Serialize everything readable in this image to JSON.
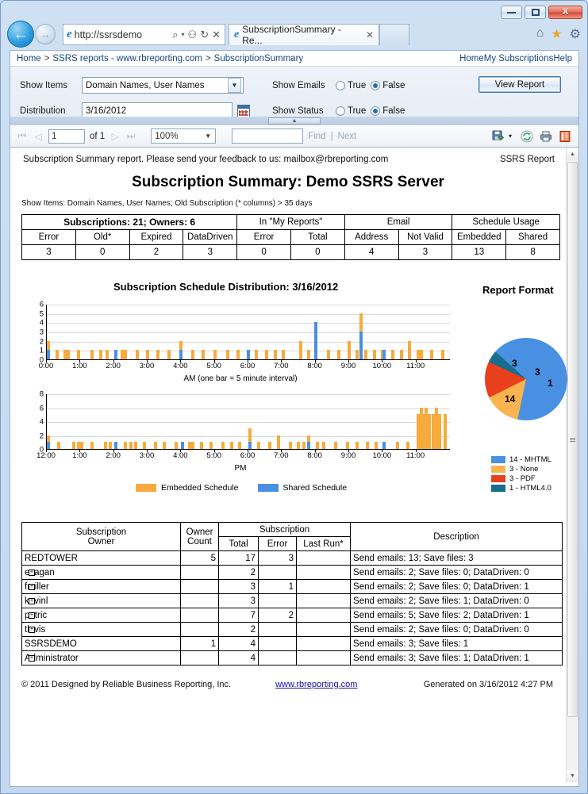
{
  "window": {
    "minimize_label": "minimize",
    "maximize_label": "maximize",
    "close_label": "X"
  },
  "browser": {
    "back_label": "←",
    "forward_label": "→",
    "address_value": "http://ssrsdemo",
    "search_icon": "⌕",
    "dropdown_icon": "▾",
    "compat_icon": "⚇",
    "refresh_icon": "↻",
    "stop_icon": "✕",
    "tab_title": "SubscriptionSummary - Re...",
    "tab_close": "✕",
    "home_icon": "⌂",
    "favorites_icon": "★",
    "tools_icon": "⚙"
  },
  "breadcrumb": {
    "items": [
      "Home",
      "SSRS reports - www.rbreporting.com",
      "SubscriptionSummary"
    ],
    "separator": ">",
    "right_links": [
      "Home",
      "My Subscriptions",
      "Help"
    ],
    "right_separator": "|"
  },
  "params": {
    "show_items_label": "Show Items",
    "show_items_value": "Domain Names, User Names",
    "distribution_label": "Distribution",
    "distribution_value": "3/16/2012",
    "show_emails_label": "Show Emails",
    "show_status_label": "Show Status",
    "true_label": "True",
    "false_label": "False",
    "show_emails_selected": "False",
    "show_status_selected": "False",
    "view_report_label": "View Report",
    "dropdown_arrow": "▼",
    "collapse_arrow": "▲"
  },
  "toolbar": {
    "first_icon": "⏮",
    "prev_icon": "◁",
    "page_value": "1",
    "of_label": "of 1",
    "next_icon": "▷",
    "last_icon": "⏭",
    "zoom_value": "100%",
    "zoom_arrow": "▼",
    "find_value": "",
    "find_label": "Find",
    "next_label": "Next",
    "separator": "|",
    "export_icon": "export-disk-icon",
    "export_arrow": "▾",
    "refresh_icon": "refresh-icon",
    "print_icon": "print-icon",
    "layout_icon": "page-layout-icon"
  },
  "report": {
    "header_text": "Subscription Summary report. Please send your feedback to us: mailbox@rbreporting.com",
    "header_right": "SSRS Report",
    "title": "Subscription Summary: Demo SSRS Server",
    "subtitle": "Show Items: Domain Names, User Names; Old Subscription (* columns) > 35 days",
    "summary_table": {
      "group_headers": [
        {
          "label": "Subscriptions: 21; Owners: 6",
          "span": 4,
          "bold": true
        },
        {
          "label": "In \"My Reports\"",
          "span": 2,
          "bold": false
        },
        {
          "label": "Email",
          "span": 2,
          "bold": false
        },
        {
          "label": "Schedule Usage",
          "span": 2,
          "bold": false
        }
      ],
      "columns": [
        "Error",
        "Old*",
        "Expired",
        "DataDriven",
        "Error",
        "Total",
        "Address",
        "Not Valid",
        "Embedded",
        "Shared"
      ],
      "values": [
        "3",
        "0",
        "2",
        "3",
        "0",
        "0",
        "4",
        "3",
        "13",
        "8"
      ]
    },
    "detail_table": {
      "header": {
        "owner": "Subscription\nOwner",
        "owner_line1": "Subscription",
        "owner_line2": "Owner",
        "count_line1": "Owner",
        "count_line2": "Count",
        "subscription": "Subscription",
        "total": "Total",
        "error": "Error",
        "last_run": "Last Run*",
        "description": "Description"
      },
      "rows": [
        {
          "name": "REDTOWER",
          "indent": false,
          "count": "5",
          "total": "17",
          "error": "3",
          "last_run": "",
          "desc": "Send emails: 13; Save files: 3",
          "small": false
        },
        {
          "name": "esagan",
          "indent": true,
          "count": "",
          "total": "2",
          "error": "",
          "last_run": "",
          "desc": "Send emails: 2; Save files: 0; DataDriven: 0",
          "small": true
        },
        {
          "name": "fmiller",
          "indent": true,
          "count": "",
          "total": "3",
          "error": "1",
          "last_run": "",
          "desc": "Send emails: 2; Save files: 0; DataDriven: 1",
          "small": true
        },
        {
          "name": "kevinl",
          "indent": true,
          "count": "",
          "total": "3",
          "error": "",
          "last_run": "",
          "desc": "Send emails: 2; Save files: 1; DataDriven: 0",
          "small": true
        },
        {
          "name": "patric",
          "indent": true,
          "count": "",
          "total": "7",
          "error": "2",
          "last_run": "",
          "desc": "Send emails: 5; Save files: 2; DataDriven: 1",
          "small": true
        },
        {
          "name": "tlavis",
          "indent": true,
          "count": "",
          "total": "2",
          "error": "",
          "last_run": "",
          "desc": "Send emails: 2; Save files: 0; DataDriven: 0",
          "small": true
        },
        {
          "name": "SSRSDEMO",
          "indent": false,
          "count": "1",
          "total": "4",
          "error": "",
          "last_run": "",
          "desc": "Send emails: 3; Save files: 1",
          "small": false
        },
        {
          "name": "Administrator",
          "indent": true,
          "count": "",
          "total": "4",
          "error": "",
          "last_run": "",
          "desc": "Send emails: 3; Save files: 1; DataDriven: 1",
          "small": true
        }
      ],
      "expander_icon": "⊞"
    },
    "footer": {
      "copyright": "© 2011 Designed by Reliable Business Reporting, Inc.",
      "link": "www.rbreporting.com",
      "generated": "Generated on 3/16/2012 4:27 PM"
    }
  },
  "colors": {
    "embedded": "#f6ab3c",
    "shared": "#4a90e2",
    "mhtml": "#4a90e2",
    "none": "#f9b450",
    "pdf": "#e8401c",
    "html40": "#176d8e"
  },
  "chart_data": [
    {
      "type": "bar",
      "title": "Subscription Schedule Distribution: 3/16/2012",
      "xlabel": "AM (one bar = 5 minute interval)",
      "ylabel": "",
      "ylim": [
        0,
        6
      ],
      "yticks": [
        0,
        1,
        2,
        3,
        4,
        5,
        6
      ],
      "xticks": [
        "0:00",
        "1:00",
        "2:00",
        "3:00",
        "4:00",
        "5:00",
        "6:00",
        "7:00",
        "8:00",
        "9:00",
        "10:00",
        "11:00"
      ],
      "grid": true,
      "legend": [
        "Embedded Schedule",
        "Shared Schedule"
      ],
      "legend_position": "bottom",
      "series": [
        {
          "name": "Embedded Schedule",
          "color": "#f6ab3c",
          "points": [
            [
              0,
              2
            ],
            [
              0.25,
              1
            ],
            [
              0.5,
              1
            ],
            [
              0.6,
              1
            ],
            [
              0.9,
              1
            ],
            [
              1.3,
              1
            ],
            [
              1.55,
              1
            ],
            [
              1.75,
              1
            ],
            [
              2.0,
              1
            ],
            [
              2.2,
              1
            ],
            [
              2.3,
              1
            ],
            [
              2.65,
              1
            ],
            [
              2.95,
              1
            ],
            [
              3.25,
              1
            ],
            [
              3.6,
              1
            ],
            [
              3.95,
              2
            ],
            [
              4.3,
              1
            ],
            [
              4.6,
              1
            ],
            [
              4.95,
              1
            ],
            [
              5.35,
              1
            ],
            [
              5.65,
              1
            ],
            [
              5.95,
              1
            ],
            [
              6.2,
              1
            ],
            [
              6.5,
              1
            ],
            [
              6.75,
              1
            ],
            [
              7.0,
              1
            ],
            [
              7.5,
              2
            ],
            [
              7.75,
              1
            ],
            [
              7.95,
              1
            ],
            [
              8.35,
              1
            ],
            [
              8.65,
              1
            ],
            [
              8.95,
              2
            ],
            [
              9.2,
              1
            ],
            [
              9.3,
              5
            ],
            [
              9.45,
              1
            ],
            [
              9.7,
              1
            ],
            [
              9.95,
              1
            ],
            [
              10.25,
              1
            ],
            [
              10.5,
              1
            ],
            [
              10.75,
              2
            ],
            [
              11.0,
              1
            ],
            [
              11.1,
              1
            ],
            [
              11.4,
              1
            ],
            [
              11.75,
              1
            ]
          ]
        },
        {
          "name": "Shared Schedule",
          "color": "#4a90e2",
          "points": [
            [
              0,
              1
            ],
            [
              2.0,
              1
            ],
            [
              3.95,
              1
            ],
            [
              5.95,
              1
            ],
            [
              7.95,
              4
            ],
            [
              9.3,
              3
            ],
            [
              10.0,
              1
            ]
          ]
        }
      ]
    },
    {
      "type": "bar",
      "title": "",
      "xlabel": "PM",
      "ylabel": "",
      "ylim": [
        0,
        8
      ],
      "yticks": [
        0,
        2,
        4,
        6,
        8
      ],
      "xticks": [
        "12:00",
        "1:00",
        "2:00",
        "3:00",
        "4:00",
        "5:00",
        "6:00",
        "7:00",
        "8:00",
        "9:00",
        "10:00",
        "11:00"
      ],
      "grid": true,
      "legend": [
        "Embedded Schedule",
        "Shared Schedule"
      ],
      "legend_position": "bottom",
      "series": [
        {
          "name": "Embedded Schedule",
          "color": "#f6ab3c",
          "points": [
            [
              0,
              2
            ],
            [
              0.3,
              1
            ],
            [
              0.75,
              1
            ],
            [
              0.9,
              1
            ],
            [
              1.0,
              1
            ],
            [
              1.3,
              1
            ],
            [
              1.7,
              1
            ],
            [
              1.85,
              1
            ],
            [
              2.0,
              1
            ],
            [
              2.3,
              1
            ],
            [
              2.45,
              1
            ],
            [
              2.6,
              1
            ],
            [
              2.85,
              1
            ],
            [
              3.2,
              1
            ],
            [
              3.45,
              1
            ],
            [
              3.8,
              1
            ],
            [
              4.0,
              1
            ],
            [
              4.2,
              1
            ],
            [
              4.3,
              1
            ],
            [
              4.55,
              1
            ],
            [
              4.85,
              1
            ],
            [
              5.2,
              1
            ],
            [
              5.45,
              1
            ],
            [
              5.7,
              1
            ],
            [
              6.0,
              3
            ],
            [
              6.25,
              1
            ],
            [
              6.6,
              1
            ],
            [
              6.85,
              2
            ],
            [
              7.2,
              1
            ],
            [
              7.45,
              1
            ],
            [
              7.6,
              1
            ],
            [
              7.75,
              2
            ],
            [
              8.0,
              1
            ],
            [
              8.2,
              1
            ],
            [
              8.55,
              1
            ],
            [
              8.9,
              1
            ],
            [
              9.2,
              1
            ],
            [
              9.5,
              1
            ],
            [
              9.75,
              1
            ],
            [
              10.0,
              1
            ],
            [
              10.4,
              1
            ],
            [
              10.7,
              1
            ],
            [
              11.0,
              5
            ],
            [
              11.1,
              6
            ],
            [
              11.15,
              5
            ],
            [
              11.25,
              6
            ],
            [
              11.35,
              5
            ],
            [
              11.45,
              5
            ],
            [
              11.55,
              6
            ],
            [
              11.65,
              5
            ],
            [
              11.8,
              5
            ]
          ]
        },
        {
          "name": "Shared Schedule",
          "color": "#4a90e2",
          "points": [
            [
              0,
              1
            ],
            [
              2.0,
              1
            ],
            [
              4.0,
              1
            ],
            [
              6.0,
              1
            ],
            [
              7.75,
              1
            ],
            [
              10.0,
              1
            ]
          ]
        }
      ]
    },
    {
      "type": "pie",
      "title": "Report Format",
      "labels": [
        "14 - MHTML",
        "3 - None",
        "3 - PDF",
        "1 - HTML4.0"
      ],
      "slice_labels": [
        "14",
        "3",
        "3",
        "1"
      ],
      "values": [
        14,
        3,
        3,
        1
      ],
      "colors": [
        "#4a90e2",
        "#f9b450",
        "#e8401c",
        "#176d8e"
      ],
      "legend_position": "bottom"
    }
  ]
}
